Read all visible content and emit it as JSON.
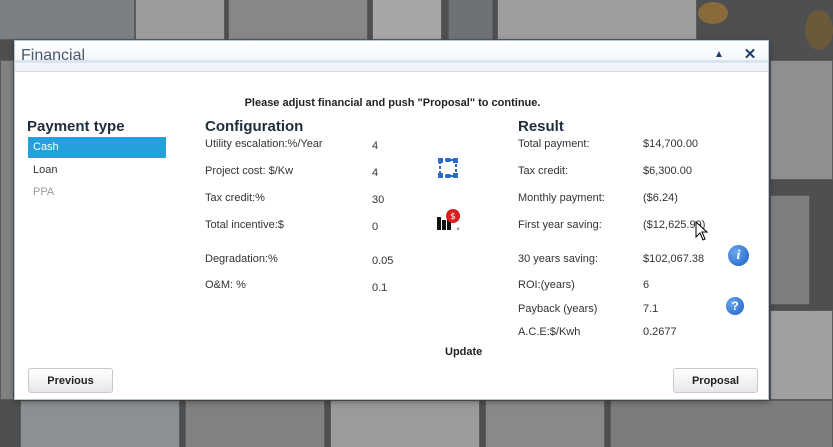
{
  "window": {
    "title": "Financial",
    "collapse_icon": "triangle-up-icon",
    "close_icon": "close-icon"
  },
  "instruction": "Please adjust financial and push \"Proposal\" to continue.",
  "payment_type": {
    "heading": "Payment type",
    "items": [
      {
        "label": "Cash",
        "state": "selected"
      },
      {
        "label": "Loan",
        "state": "normal"
      },
      {
        "label": "PPA",
        "state": "disabled"
      }
    ]
  },
  "configuration": {
    "heading": "Configuration",
    "rows": [
      {
        "label": "Utility escalation:%/Year",
        "value": "4"
      },
      {
        "label": "Project cost: $/Kw",
        "value": "4"
      },
      {
        "label": "Tax credit:%",
        "value": "30"
      },
      {
        "label": "Total incentive:$",
        "value": "0"
      },
      {
        "label": "Degradation:%",
        "value": "0.05"
      },
      {
        "label": "O&M: %",
        "value": "0.1"
      }
    ],
    "icons": [
      "expand-grid-icon",
      "incentive-chart-icon"
    ]
  },
  "result": {
    "heading": "Result",
    "rows": [
      {
        "label": "Total payment:",
        "value": "$14,700.00"
      },
      {
        "label": "Tax credit:",
        "value": "$6,300.00"
      },
      {
        "label": "Monthly payment:",
        "value": "($6.24)"
      },
      {
        "label": "First year saving:",
        "value": "($12,625.99)"
      },
      {
        "label": "30 years saving:",
        "value": "$102,067.38"
      },
      {
        "label": "ROI:(years)",
        "value": "6"
      },
      {
        "label": "Payback (years)",
        "value": "7.1"
      },
      {
        "label": "A.C.E:$/Kwh",
        "value": "0.2677"
      }
    ],
    "icons": [
      "info-icon",
      "help-icon"
    ],
    "info_glyph": "i",
    "help_glyph": "?"
  },
  "actions": {
    "update": "Update",
    "previous": "Previous",
    "proposal": "Proposal"
  },
  "colors": {
    "selected_bg": "#26a0da",
    "title_text": "#4a5a6a",
    "icon_blue": "#1b5cc4"
  }
}
